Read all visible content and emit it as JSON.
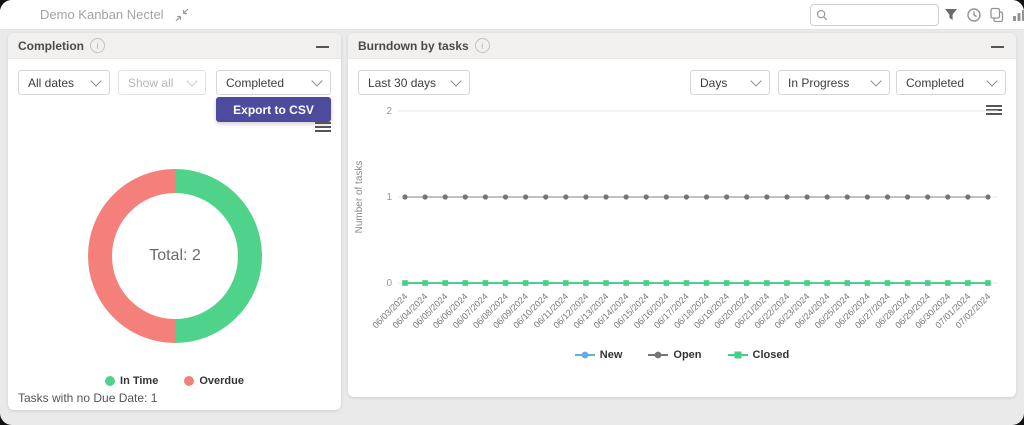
{
  "topbar": {
    "board_title": "Demo Kanban Nectel",
    "search": {
      "value": "",
      "placeholder": ""
    }
  },
  "completion": {
    "title": "Completion",
    "filters": [
      {
        "value": "All dates",
        "disabled": false
      },
      {
        "value": "Show all",
        "disabled": true
      },
      {
        "value": "Completed",
        "disabled": false
      }
    ],
    "export_label": "Export to CSV",
    "footer_note": "Tasks with no Due Date: 1"
  },
  "burndown": {
    "title": "Burndown by tasks",
    "filters": [
      {
        "value": "Last 30 days"
      },
      {
        "value": "Days"
      },
      {
        "value": "In Progress"
      },
      {
        "value": "Completed"
      }
    ]
  },
  "colors": {
    "accent_button": "#4c4b9d",
    "in_time": "#4fd38a",
    "overdue": "#f5807b",
    "series_new": "#64aede",
    "series_open": "#757575",
    "series_closed": "#45d087",
    "grid": "#e8e8e8"
  },
  "chart_data": [
    {
      "type": "pie",
      "subtype": "donut",
      "title": "Completion",
      "labels": [
        "In Time",
        "Overdue"
      ],
      "values": [
        1,
        1
      ],
      "colors": [
        "#4fd38a",
        "#f5807b"
      ],
      "center_label": "Total: 2",
      "legend_position": "bottom"
    },
    {
      "type": "line",
      "title": "Burndown by tasks",
      "x": [
        "06/03/2024",
        "06/04/2024",
        "06/05/2024",
        "06/06/2024",
        "06/07/2024",
        "06/08/2024",
        "06/09/2024",
        "06/10/2024",
        "06/11/2024",
        "06/12/2024",
        "06/13/2024",
        "06/14/2024",
        "06/15/2024",
        "06/16/2024",
        "06/17/2024",
        "06/18/2024",
        "06/19/2024",
        "06/20/2024",
        "06/21/2024",
        "06/22/2024",
        "06/23/2024",
        "06/24/2024",
        "06/25/2024",
        "06/26/2024",
        "06/27/2024",
        "06/28/2024",
        "06/29/2024",
        "06/30/2024",
        "07/01/2024",
        "07/02/2024"
      ],
      "series": [
        {
          "name": "New",
          "color": "#64aede",
          "marker": "circle",
          "values": [
            0,
            0,
            0,
            0,
            0,
            0,
            0,
            0,
            0,
            0,
            0,
            0,
            0,
            0,
            0,
            0,
            0,
            0,
            0,
            0,
            0,
            0,
            0,
            0,
            0,
            0,
            0,
            0,
            0,
            0
          ]
        },
        {
          "name": "Open",
          "color": "#757575",
          "marker": "circle",
          "values": [
            1,
            1,
            1,
            1,
            1,
            1,
            1,
            1,
            1,
            1,
            1,
            1,
            1,
            1,
            1,
            1,
            1,
            1,
            1,
            1,
            1,
            1,
            1,
            1,
            1,
            1,
            1,
            1,
            1,
            1
          ]
        },
        {
          "name": "Closed",
          "color": "#45d087",
          "marker": "square",
          "values": [
            0,
            0,
            0,
            0,
            0,
            0,
            0,
            0,
            0,
            0,
            0,
            0,
            0,
            0,
            0,
            0,
            0,
            0,
            0,
            0,
            0,
            0,
            0,
            0,
            0,
            0,
            0,
            0,
            0,
            0
          ]
        }
      ],
      "ylabel": "Number of tasks",
      "ylim": [
        0,
        2
      ],
      "yticks": [
        0,
        1,
        2
      ],
      "grid": true,
      "legend_position": "bottom"
    }
  ]
}
